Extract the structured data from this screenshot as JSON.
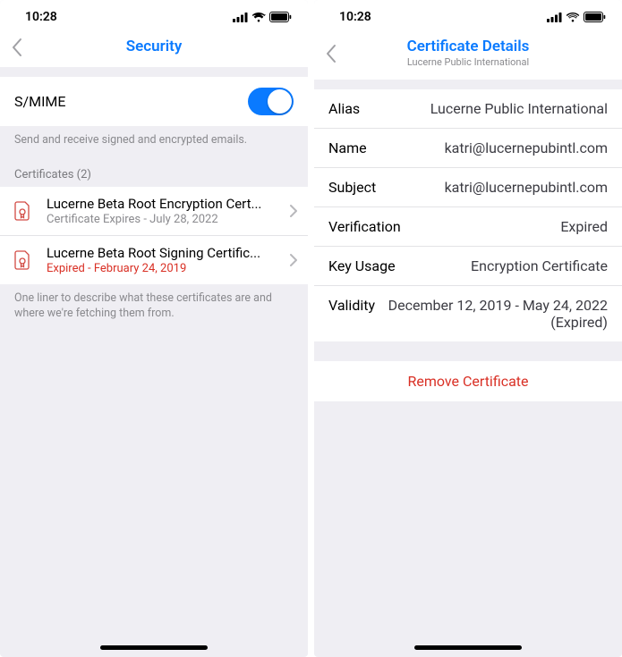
{
  "left": {
    "status_time": "10:28",
    "nav_title": "Security",
    "smime": {
      "label": "S/MIME",
      "footer": "Send and receive signed and encrypted emails."
    },
    "certs_header": "Certificates (2)",
    "certs": [
      {
        "title": "Lucerne Beta Root Encryption Cert...",
        "sub": "Certificate Expires - July 28, 2022",
        "expired": false
      },
      {
        "title": "Lucerne Beta Root Signing Certific...",
        "sub": "Expired - February 24, 2019",
        "expired": true
      }
    ],
    "certs_footer": "One liner to describe what these certificates are and where we're fetching them from."
  },
  "right": {
    "status_time": "10:28",
    "nav_title": "Certificate Details",
    "nav_sub": "Lucerne Public International",
    "rows": {
      "alias_label": "Alias",
      "alias_value": "Lucerne Public International",
      "name_label": "Name",
      "name_value": "katri@lucernepubintl.com",
      "subject_label": "Subject",
      "subject_value": "katri@lucernepubintl.com",
      "verification_label": "Verification",
      "verification_value": "Expired",
      "keyusage_label": "Key Usage",
      "keyusage_value": "Encryption Certificate",
      "validity_label": "Validity",
      "validity_value": "December 12, 2019 - May 24, 2022 (Expired)"
    },
    "remove_label": "Remove Certificate"
  }
}
